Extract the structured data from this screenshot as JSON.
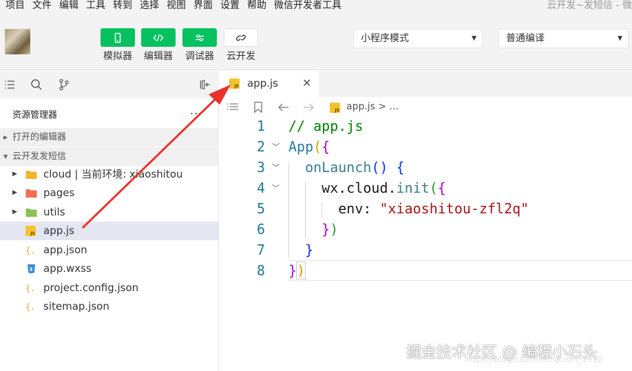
{
  "menubar": {
    "items": [
      "项目",
      "文件",
      "编辑",
      "工具",
      "转到",
      "选择",
      "视图",
      "界面",
      "设置",
      "帮助",
      "微信开发者工具"
    ],
    "window_title": "云开发~发短信 - 微"
  },
  "toolbar": {
    "buttons": [
      {
        "label": "模拟器",
        "icon": "phone-icon"
      },
      {
        "label": "编辑器",
        "icon": "code-icon"
      },
      {
        "label": "调试器",
        "icon": "debug-sliders-icon"
      },
      {
        "label": "云开发",
        "icon": "cloud-link-icon"
      }
    ],
    "mode_select": "小程序模式",
    "compile_select": "普通编译"
  },
  "sidebar": {
    "resource_title": "资源管理器",
    "more": "...",
    "open_editors": "打开的编辑器",
    "project_name": "云开发发短信",
    "tree": [
      {
        "name": "cloud | 当前环境: xiaoshitou",
        "type": "folder",
        "color": "#f2b531"
      },
      {
        "name": "pages",
        "type": "folder",
        "color": "#f26d4f"
      },
      {
        "name": "utils",
        "type": "folder",
        "color": "#8cc153"
      },
      {
        "name": "app.js",
        "type": "js"
      },
      {
        "name": "app.json",
        "type": "json"
      },
      {
        "name": "app.wxss",
        "type": "css"
      },
      {
        "name": "project.config.json",
        "type": "json"
      },
      {
        "name": "sitemap.json",
        "type": "json"
      }
    ]
  },
  "editor": {
    "tab_label": "app.js",
    "breadcrumb": "app.js > ...",
    "line_numbers": [
      "1",
      "2",
      "3",
      "4",
      "5",
      "6",
      "7",
      "8"
    ],
    "code": {
      "comment": "// app.js",
      "app": "App",
      "onlaunch": "onLaunch",
      "wxcloud": "wx.cloud.",
      "init": "init",
      "env_key": "env: ",
      "env_val": "\"xiaoshitou-zfl2q\""
    }
  },
  "watermark": {
    "main": "掘金技术社区 @ 编程小石头",
    "sub": "https://blog.csdn.net/qiushi_1990"
  },
  "colors": {
    "accent_green": "#07c160",
    "annotation_red": "#e8322b",
    "selection": "#e4e6f1"
  }
}
